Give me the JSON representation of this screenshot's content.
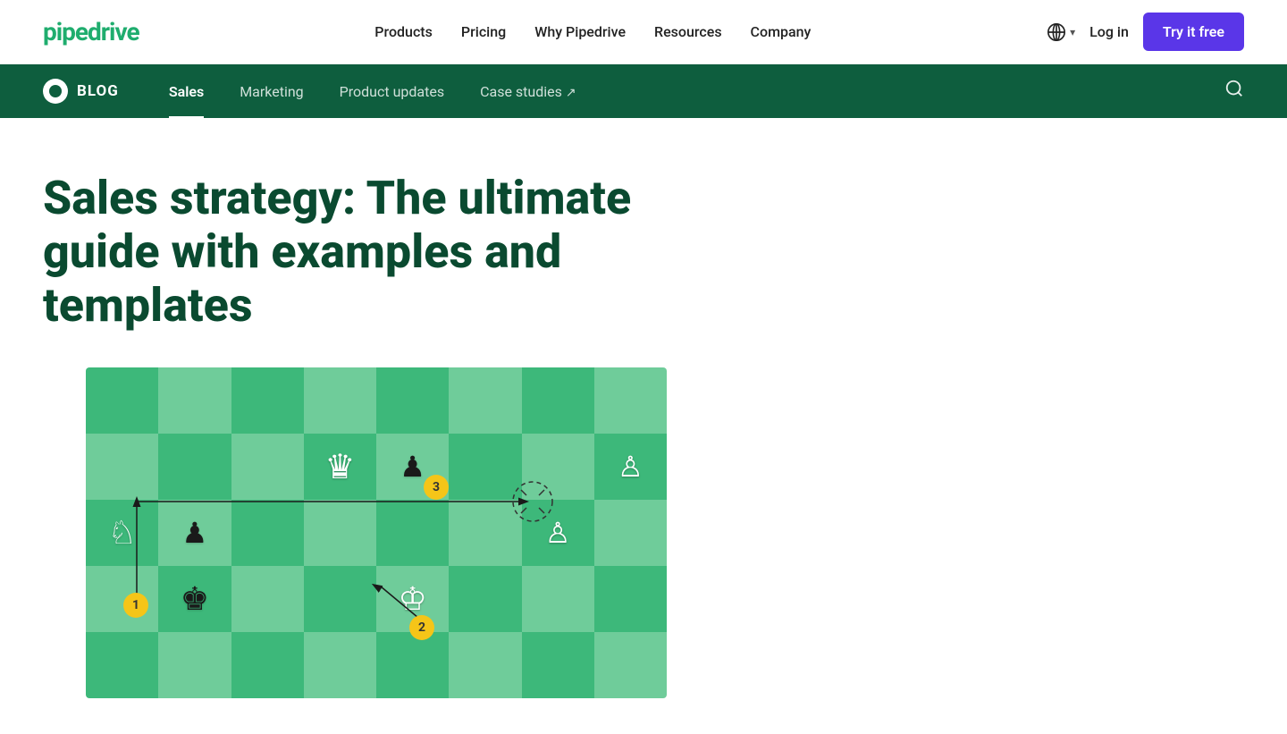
{
  "brand": {
    "logo": "pipedrive",
    "logo_color": "#1fad6e"
  },
  "top_nav": {
    "links": [
      {
        "id": "products",
        "label": "Products"
      },
      {
        "id": "pricing",
        "label": "Pricing"
      },
      {
        "id": "why-pipedrive",
        "label": "Why Pipedrive"
      },
      {
        "id": "resources",
        "label": "Resources"
      },
      {
        "id": "company",
        "label": "Company"
      }
    ],
    "login_label": "Log in",
    "try_free_label": "Try it free",
    "globe_label": ""
  },
  "blog_nav": {
    "blog_label": "BLOG",
    "links": [
      {
        "id": "sales",
        "label": "Sales",
        "active": true
      },
      {
        "id": "marketing",
        "label": "Marketing",
        "active": false
      },
      {
        "id": "product-updates",
        "label": "Product updates",
        "active": false
      },
      {
        "id": "case-studies",
        "label": "Case studies",
        "active": false,
        "external": true
      }
    ]
  },
  "article": {
    "title": "Sales strategy: The ultimate guide with examples and templates"
  },
  "chess": {
    "badge1": "1",
    "badge2": "2",
    "badge3": "3"
  }
}
